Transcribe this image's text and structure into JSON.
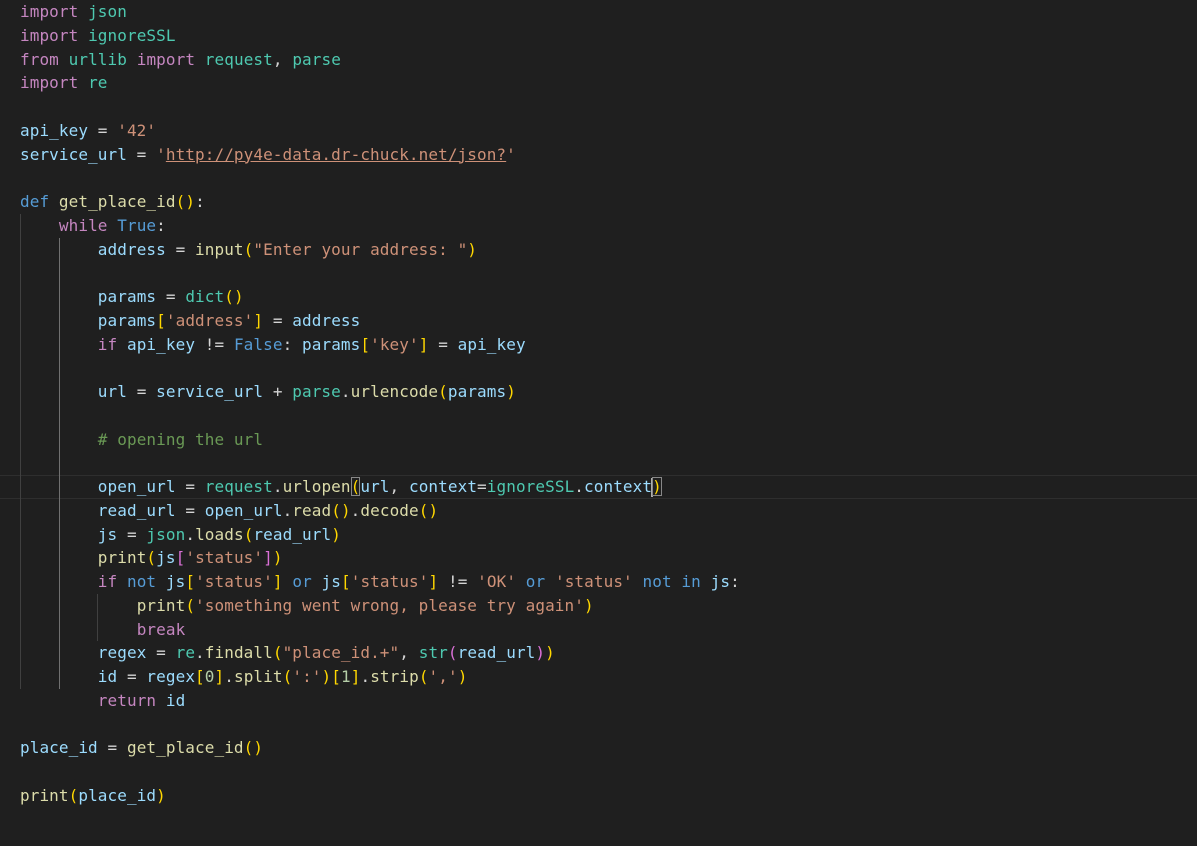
{
  "editor": {
    "language": "python",
    "colors": {
      "background": "#1f1f1f",
      "keyword": "#c586c0",
      "storage": "#569cd6",
      "function": "#dcdcaa",
      "variable": "#9cdcfe",
      "module": "#4ec9b0",
      "string": "#ce9178",
      "number": "#b5cea8",
      "comment": "#6a9955",
      "bracket_level_1": "#ffd700",
      "bracket_level_2": "#da70d6",
      "bracket_level_3": "#179fff"
    },
    "lines": [
      [
        {
          "t": "import",
          "c": "kw"
        },
        {
          "t": " "
        },
        {
          "t": "json",
          "c": "mod"
        }
      ],
      [
        {
          "t": "import",
          "c": "kw"
        },
        {
          "t": " "
        },
        {
          "t": "ignoreSSL",
          "c": "mod"
        }
      ],
      [
        {
          "t": "from",
          "c": "kw"
        },
        {
          "t": " "
        },
        {
          "t": "urllib",
          "c": "mod"
        },
        {
          "t": " "
        },
        {
          "t": "import",
          "c": "kw"
        },
        {
          "t": " "
        },
        {
          "t": "request",
          "c": "mod"
        },
        {
          "t": ", ",
          "c": "op"
        },
        {
          "t": "parse",
          "c": "mod"
        }
      ],
      [
        {
          "t": "import",
          "c": "kw"
        },
        {
          "t": " "
        },
        {
          "t": "re",
          "c": "mod"
        }
      ],
      [],
      [
        {
          "t": "api_key",
          "c": "var"
        },
        {
          "t": " = ",
          "c": "op"
        },
        {
          "t": "'42'",
          "c": "str"
        }
      ],
      [
        {
          "t": "service_url",
          "c": "var"
        },
        {
          "t": " = ",
          "c": "op"
        },
        {
          "t": "'",
          "c": "str"
        },
        {
          "t": "http://py4e-data.dr-chuck.net/json?",
          "c": "str url"
        },
        {
          "t": "'",
          "c": "str"
        }
      ],
      [],
      [
        {
          "t": "def",
          "c": "def"
        },
        {
          "t": " "
        },
        {
          "t": "get_place_id",
          "c": "fn"
        },
        {
          "t": "(",
          "c": "b1"
        },
        {
          "t": ")",
          "c": "b1"
        },
        {
          "t": ":",
          "c": "op"
        }
      ],
      [
        {
          "t": "    "
        },
        {
          "t": "while",
          "c": "kw"
        },
        {
          "t": " "
        },
        {
          "t": "True",
          "c": "def"
        },
        {
          "t": ":",
          "c": "op"
        }
      ],
      [
        {
          "t": "        "
        },
        {
          "t": "address",
          "c": "var"
        },
        {
          "t": " = ",
          "c": "op"
        },
        {
          "t": "input",
          "c": "fn"
        },
        {
          "t": "(",
          "c": "b1"
        },
        {
          "t": "\"Enter your address: \"",
          "c": "str"
        },
        {
          "t": ")",
          "c": "b1"
        }
      ],
      [],
      [
        {
          "t": "        "
        },
        {
          "t": "params",
          "c": "var"
        },
        {
          "t": " = ",
          "c": "op"
        },
        {
          "t": "dict",
          "c": "mod"
        },
        {
          "t": "(",
          "c": "b1"
        },
        {
          "t": ")",
          "c": "b1"
        }
      ],
      [
        {
          "t": "        "
        },
        {
          "t": "params",
          "c": "var"
        },
        {
          "t": "[",
          "c": "b1"
        },
        {
          "t": "'address'",
          "c": "str"
        },
        {
          "t": "]",
          "c": "b1"
        },
        {
          "t": " = ",
          "c": "op"
        },
        {
          "t": "address",
          "c": "var"
        }
      ],
      [
        {
          "t": "        "
        },
        {
          "t": "if",
          "c": "kw"
        },
        {
          "t": " "
        },
        {
          "t": "api_key",
          "c": "var"
        },
        {
          "t": " != ",
          "c": "op"
        },
        {
          "t": "False",
          "c": "def"
        },
        {
          "t": ": ",
          "c": "op"
        },
        {
          "t": "params",
          "c": "var"
        },
        {
          "t": "[",
          "c": "b1"
        },
        {
          "t": "'key'",
          "c": "str"
        },
        {
          "t": "]",
          "c": "b1"
        },
        {
          "t": " = ",
          "c": "op"
        },
        {
          "t": "api_key",
          "c": "var"
        }
      ],
      [],
      [
        {
          "t": "        "
        },
        {
          "t": "url",
          "c": "var"
        },
        {
          "t": " = ",
          "c": "op"
        },
        {
          "t": "service_url",
          "c": "var"
        },
        {
          "t": " + ",
          "c": "op"
        },
        {
          "t": "parse",
          "c": "mod"
        },
        {
          "t": ".",
          "c": "op"
        },
        {
          "t": "urlencode",
          "c": "fn"
        },
        {
          "t": "(",
          "c": "b1"
        },
        {
          "t": "params",
          "c": "var"
        },
        {
          "t": ")",
          "c": "b1"
        }
      ],
      [],
      [
        {
          "t": "        "
        },
        {
          "t": "# opening the url",
          "c": "cmt"
        }
      ],
      [],
      [
        {
          "t": "        "
        },
        {
          "t": "open_url",
          "c": "var"
        },
        {
          "t": " = ",
          "c": "op"
        },
        {
          "t": "request",
          "c": "mod"
        },
        {
          "t": ".",
          "c": "op"
        },
        {
          "t": "urlopen",
          "c": "fn"
        },
        {
          "t": "(",
          "c": "b1 match"
        },
        {
          "t": "url",
          "c": "var"
        },
        {
          "t": ", ",
          "c": "op"
        },
        {
          "t": "context",
          "c": "var"
        },
        {
          "t": "=",
          "c": "op"
        },
        {
          "t": "ignoreSSL",
          "c": "mod"
        },
        {
          "t": ".",
          "c": "op"
        },
        {
          "t": "context",
          "c": "var"
        },
        {
          "c": "cursor"
        },
        {
          "t": ")",
          "c": "b1 match"
        }
      ],
      [
        {
          "t": "        "
        },
        {
          "t": "read_url",
          "c": "var"
        },
        {
          "t": " = ",
          "c": "op"
        },
        {
          "t": "open_url",
          "c": "var"
        },
        {
          "t": ".",
          "c": "op"
        },
        {
          "t": "read",
          "c": "fn"
        },
        {
          "t": "(",
          "c": "b1"
        },
        {
          "t": ")",
          "c": "b1"
        },
        {
          "t": ".",
          "c": "op"
        },
        {
          "t": "decode",
          "c": "fn"
        },
        {
          "t": "(",
          "c": "b1"
        },
        {
          "t": ")",
          "c": "b1"
        }
      ],
      [
        {
          "t": "        "
        },
        {
          "t": "js",
          "c": "var"
        },
        {
          "t": " = ",
          "c": "op"
        },
        {
          "t": "json",
          "c": "mod"
        },
        {
          "t": ".",
          "c": "op"
        },
        {
          "t": "loads",
          "c": "fn"
        },
        {
          "t": "(",
          "c": "b1"
        },
        {
          "t": "read_url",
          "c": "var"
        },
        {
          "t": ")",
          "c": "b1"
        }
      ],
      [
        {
          "t": "        "
        },
        {
          "t": "print",
          "c": "fn"
        },
        {
          "t": "(",
          "c": "b1"
        },
        {
          "t": "js",
          "c": "var"
        },
        {
          "t": "[",
          "c": "b2"
        },
        {
          "t": "'status'",
          "c": "str"
        },
        {
          "t": "]",
          "c": "b2"
        },
        {
          "t": ")",
          "c": "b1"
        }
      ],
      [
        {
          "t": "        "
        },
        {
          "t": "if",
          "c": "kw"
        },
        {
          "t": " "
        },
        {
          "t": "not",
          "c": "def"
        },
        {
          "t": " "
        },
        {
          "t": "js",
          "c": "var"
        },
        {
          "t": "[",
          "c": "b1"
        },
        {
          "t": "'status'",
          "c": "str"
        },
        {
          "t": "]",
          "c": "b1"
        },
        {
          "t": " "
        },
        {
          "t": "or",
          "c": "def"
        },
        {
          "t": " "
        },
        {
          "t": "js",
          "c": "var"
        },
        {
          "t": "[",
          "c": "b1"
        },
        {
          "t": "'status'",
          "c": "str"
        },
        {
          "t": "]",
          "c": "b1"
        },
        {
          "t": " != ",
          "c": "op"
        },
        {
          "t": "'OK'",
          "c": "str"
        },
        {
          "t": " "
        },
        {
          "t": "or",
          "c": "def"
        },
        {
          "t": " "
        },
        {
          "t": "'status'",
          "c": "str"
        },
        {
          "t": " "
        },
        {
          "t": "not",
          "c": "def"
        },
        {
          "t": " "
        },
        {
          "t": "in",
          "c": "def"
        },
        {
          "t": " "
        },
        {
          "t": "js",
          "c": "var"
        },
        {
          "t": ":",
          "c": "op"
        }
      ],
      [
        {
          "t": "            "
        },
        {
          "t": "print",
          "c": "fn"
        },
        {
          "t": "(",
          "c": "b1"
        },
        {
          "t": "'something went wrong, please try again'",
          "c": "str"
        },
        {
          "t": ")",
          "c": "b1"
        }
      ],
      [
        {
          "t": "            "
        },
        {
          "t": "break",
          "c": "kw"
        }
      ],
      [
        {
          "t": "        "
        },
        {
          "t": "regex",
          "c": "var"
        },
        {
          "t": " = ",
          "c": "op"
        },
        {
          "t": "re",
          "c": "mod"
        },
        {
          "t": ".",
          "c": "op"
        },
        {
          "t": "findall",
          "c": "fn"
        },
        {
          "t": "(",
          "c": "b1"
        },
        {
          "t": "\"place_id.+\"",
          "c": "str"
        },
        {
          "t": ", ",
          "c": "op"
        },
        {
          "t": "str",
          "c": "mod"
        },
        {
          "t": "(",
          "c": "b2"
        },
        {
          "t": "read_url",
          "c": "var"
        },
        {
          "t": ")",
          "c": "b2"
        },
        {
          "t": ")",
          "c": "b1"
        }
      ],
      [
        {
          "t": "        "
        },
        {
          "t": "id",
          "c": "var"
        },
        {
          "t": " = ",
          "c": "op"
        },
        {
          "t": "regex",
          "c": "var"
        },
        {
          "t": "[",
          "c": "b1"
        },
        {
          "t": "0",
          "c": "num"
        },
        {
          "t": "]",
          "c": "b1"
        },
        {
          "t": ".",
          "c": "op"
        },
        {
          "t": "split",
          "c": "fn"
        },
        {
          "t": "(",
          "c": "b1"
        },
        {
          "t": "':'",
          "c": "str"
        },
        {
          "t": ")",
          "c": "b1"
        },
        {
          "t": "[",
          "c": "b1"
        },
        {
          "t": "1",
          "c": "num"
        },
        {
          "t": "]",
          "c": "b1"
        },
        {
          "t": ".",
          "c": "op"
        },
        {
          "t": "strip",
          "c": "fn"
        },
        {
          "t": "(",
          "c": "b1"
        },
        {
          "t": "','",
          "c": "str"
        },
        {
          "t": ")",
          "c": "b1"
        }
      ],
      [
        {
          "t": "        "
        },
        {
          "t": "return",
          "c": "kw"
        },
        {
          "t": " "
        },
        {
          "t": "id",
          "c": "var"
        }
      ],
      [],
      [
        {
          "t": "place_id",
          "c": "var"
        },
        {
          "t": " = ",
          "c": "op"
        },
        {
          "t": "get_place_id",
          "c": "fn"
        },
        {
          "t": "(",
          "c": "b1"
        },
        {
          "t": ")",
          "c": "b1"
        }
      ],
      [],
      [
        {
          "t": "print",
          "c": "fn"
        },
        {
          "t": "(",
          "c": "b1"
        },
        {
          "t": "place_id",
          "c": "var"
        },
        {
          "t": ")",
          "c": "b1"
        }
      ]
    ]
  }
}
